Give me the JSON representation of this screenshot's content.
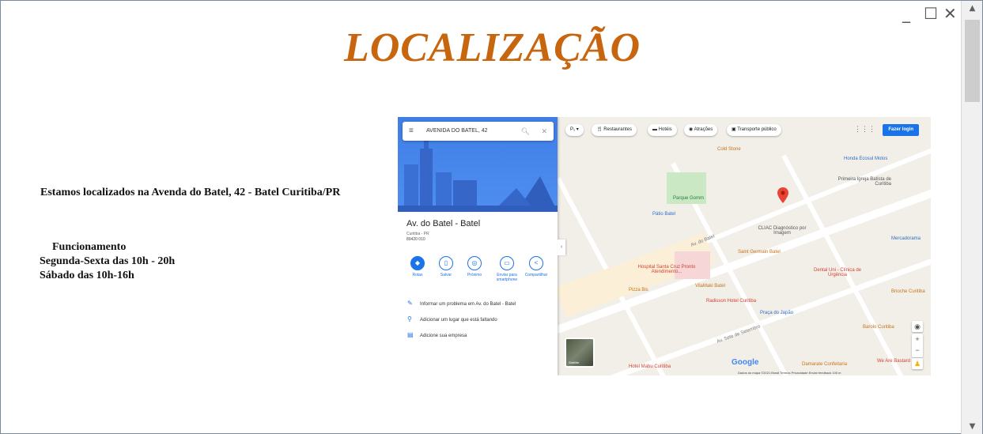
{
  "window": {
    "minimize_glyph": "_",
    "maximize_glyph": "☐",
    "close_glyph": "✕"
  },
  "page": {
    "title": "LOCALIZAÇÃO",
    "address": "Estamos localizados na Avenda do Batel, 42 - Batel Curitiba/PR",
    "hours_heading": "Funcionamento",
    "hours_weekdays": "Segunda-Sexta das 10h - 20h",
    "hours_saturday": "Sábado das 10h-16h",
    "title_color": "#c8660f"
  },
  "map": {
    "search_value": "AVENIDA DO BATEL, 42",
    "place_name": "Av. do Batel - Batel",
    "place_city": "Curitiba - PR",
    "place_cep": "80420 010",
    "actions": [
      "Rotas",
      "Salvar",
      "Próximo",
      "Enviar para smartphone",
      "Compartilhar"
    ],
    "panel_links": [
      "Informar um problema em Av. do Batel - Batel",
      "Adicionar um lugar que está faltando",
      "Adicione sua empresa"
    ],
    "chips": [
      "Restaurantes",
      "Hotéis",
      "Atrações",
      "Transporte público"
    ],
    "login_label": "Fazer login",
    "satellite_label": "Satélite",
    "footer": "Dados do mapa ©2021   Brasil   Termos   Privacidade   Enviar feedback   100 m",
    "places": [
      "Cold Stone",
      "Honda Ecosul Motos",
      "Primeira Igreja Batista de Curitiba",
      "Parque Gomm",
      "Pátio Batel",
      "CLIAC Diagnóstico por Imagem",
      "Saint Germain Batel",
      "Mercadorama",
      "Hospital Santa Cruz Pronto Atendimento...",
      "Dental Uni - Clínica de Urgência",
      "Pizza Bis",
      "VilaMaki Batel",
      "Radisson Hotel Curitiba",
      "Praça do Japão",
      "Brioche Curitiba",
      "Barolo Curitiba",
      "Hotel Mabu Curitiba",
      "Damarate Confeitaria",
      "We Are Bastard"
    ],
    "streets": [
      "Av. Sete de Setembro",
      "Av. do Batel"
    ]
  }
}
